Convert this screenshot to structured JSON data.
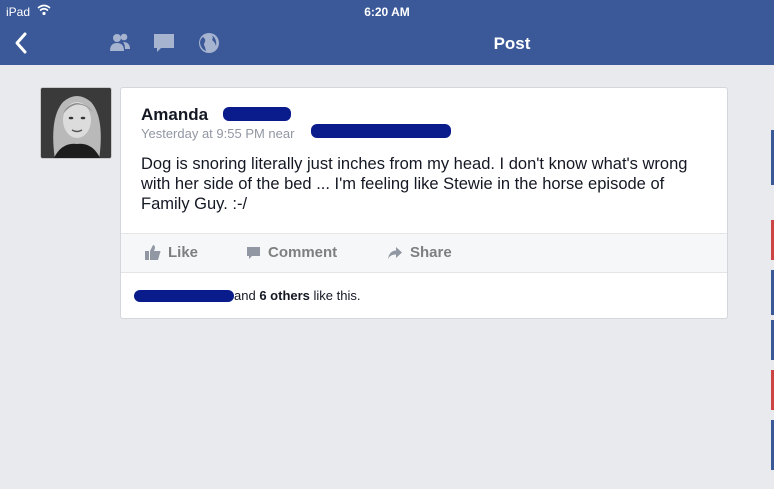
{
  "status_bar": {
    "carrier": "iPad",
    "time": "6:20 AM"
  },
  "nav": {
    "title": "Post"
  },
  "post": {
    "author_first_name": "Amanda",
    "meta_prefix": "Yesterday at 9:55 PM near",
    "body": "Dog is snoring literally just inches from my head. I don't know what's wrong with her side of the bed ... I'm feeling like Stewie in the horse episode of Family Guy. :-/",
    "actions": {
      "like": "Like",
      "comment": "Comment",
      "share": "Share"
    },
    "likes": {
      "conj": "and",
      "others": "6 others",
      "suffix": "like this."
    }
  }
}
